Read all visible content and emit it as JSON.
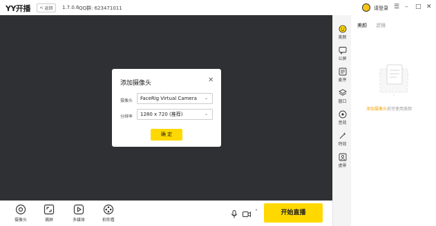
{
  "titlebar": {
    "logo": "YY开播",
    "back_label": "返回",
    "version": "1.7.0.6",
    "qqid": "QQ群: 623471011",
    "login": "请登录"
  },
  "dialog": {
    "title": "添加摄像头",
    "camera_label": "摄像头",
    "camera_value": "FaceRig Virtual Camera",
    "resolution_label": "分辨率",
    "resolution_value": "1280 x 720 (推荐)",
    "ok_label": "确 定"
  },
  "bottom_tools": [
    {
      "label": "摄像头",
      "icon": "camera-icon"
    },
    {
      "label": "捕屏",
      "icon": "capture-screen-icon"
    },
    {
      "label": "多媒体",
      "icon": "multimedia-icon"
    },
    {
      "label": "拍你看",
      "icon": "game-icon"
    }
  ],
  "start_live": "开始直播",
  "rail": [
    {
      "label": "美颜",
      "icon": "beauty-icon"
    },
    {
      "label": "公屏",
      "icon": "chat-icon"
    },
    {
      "label": "麦序",
      "icon": "mic-queue-icon"
    },
    {
      "label": "窗口",
      "icon": "layers-icon"
    },
    {
      "label": "音效",
      "icon": "sound-effect-icon"
    },
    {
      "label": "特效",
      "icon": "effects-icon"
    },
    {
      "label": "虚景",
      "icon": "virtual-bg-icon"
    }
  ],
  "panel": {
    "tab_active": "美颜",
    "tab_inactive": "滤镜",
    "empty_link": "添加摄像头",
    "empty_rest": "后可使用美颜"
  },
  "colors": {
    "accent": "#ffd800",
    "preview_bg": "#2e3034",
    "link": "#f5a500"
  }
}
